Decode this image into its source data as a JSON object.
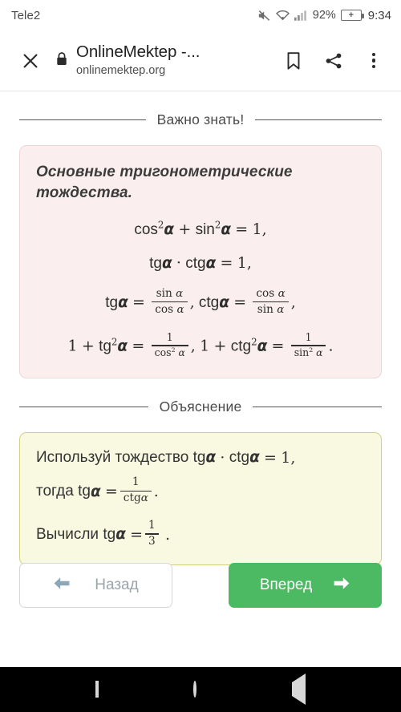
{
  "status_bar": {
    "carrier": "Tele2",
    "battery_percent": "92%",
    "battery_charging_glyph": "+",
    "time": "9:34",
    "icons": [
      "mute-icon",
      "wifi-icon",
      "signal-icon",
      "battery-icon"
    ]
  },
  "browser": {
    "close_label": "✕",
    "title": "OnlineMektep -...",
    "url": "onlinemektep.org",
    "secure": true,
    "actions": [
      "bookmark-icon",
      "share-icon",
      "overflow-menu-icon"
    ]
  },
  "sections": {
    "important": {
      "divider_label": "Важно знать!",
      "card_title": "Основные тригонометрические тождества.",
      "formulas": {
        "line1": {
          "cos": "cos",
          "pow1": "2",
          "alpha1": "α",
          "plus": "+",
          "sin": "sin",
          "pow2": "2",
          "alpha2": "α",
          "eq": "=",
          "one": "1,"
        },
        "line2": {
          "tg": "tg",
          "alpha1": "α",
          "dot": "·",
          "ctg": "ctg",
          "alpha2": "α",
          "eq": "=",
          "one": "1,"
        },
        "line3": {
          "tg": "tg",
          "alpha1": "α",
          "eq1": "=",
          "num1": "sin",
          "num1_alpha": "α",
          "den1": "cos",
          "den1_alpha": "α",
          "comma": ",",
          "ctg": "ctg",
          "alpha2": "α",
          "eq2": "=",
          "num2": "cos",
          "num2_alpha": "α",
          "den2": "sin",
          "den2_alpha": "α",
          "end": ","
        },
        "line4": {
          "one_a": "1",
          "plus_a": "+",
          "tg": "tg",
          "pow1": "2",
          "alpha1": "α",
          "eq1": "=",
          "num1": "1",
          "den1": "cos",
          "den1_pow": "2",
          "den1_alpha": "α",
          "comma": ",",
          "one_b": "1",
          "plus_b": "+",
          "ctg": "ctg",
          "pow2": "2",
          "alpha2": "α",
          "eq2": "=",
          "num2": "1",
          "den2": "sin",
          "den2_pow": "2",
          "den2_alpha": "α",
          "end": "."
        }
      }
    },
    "explanation": {
      "divider_label": "Объяснение",
      "line1": {
        "text": "Используй тождество",
        "tg": "tg",
        "alpha1": "α",
        "dot": "·",
        "ctg": "ctg",
        "alpha2": "α",
        "eq": "=",
        "one": "1,"
      },
      "line2": {
        "text": "тогда",
        "tg": "tg",
        "alpha": "α",
        "eq": "=",
        "num": "1",
        "den": "ctg",
        "den_alpha": "α",
        "end": "."
      },
      "line3": {
        "text": "Вычисли",
        "tg": "tg",
        "alpha": "α",
        "eq": "=",
        "num": "1",
        "den": "3",
        "end": "."
      }
    }
  },
  "nav_buttons": {
    "back_label": "Назад",
    "forward_label": "Вперед",
    "forward_color": "#4cb963",
    "back_arrow_color": "#8ea7b8"
  },
  "android_nav": {
    "recents": "square-recents",
    "home": "circle-home",
    "back": "triangle-back"
  }
}
